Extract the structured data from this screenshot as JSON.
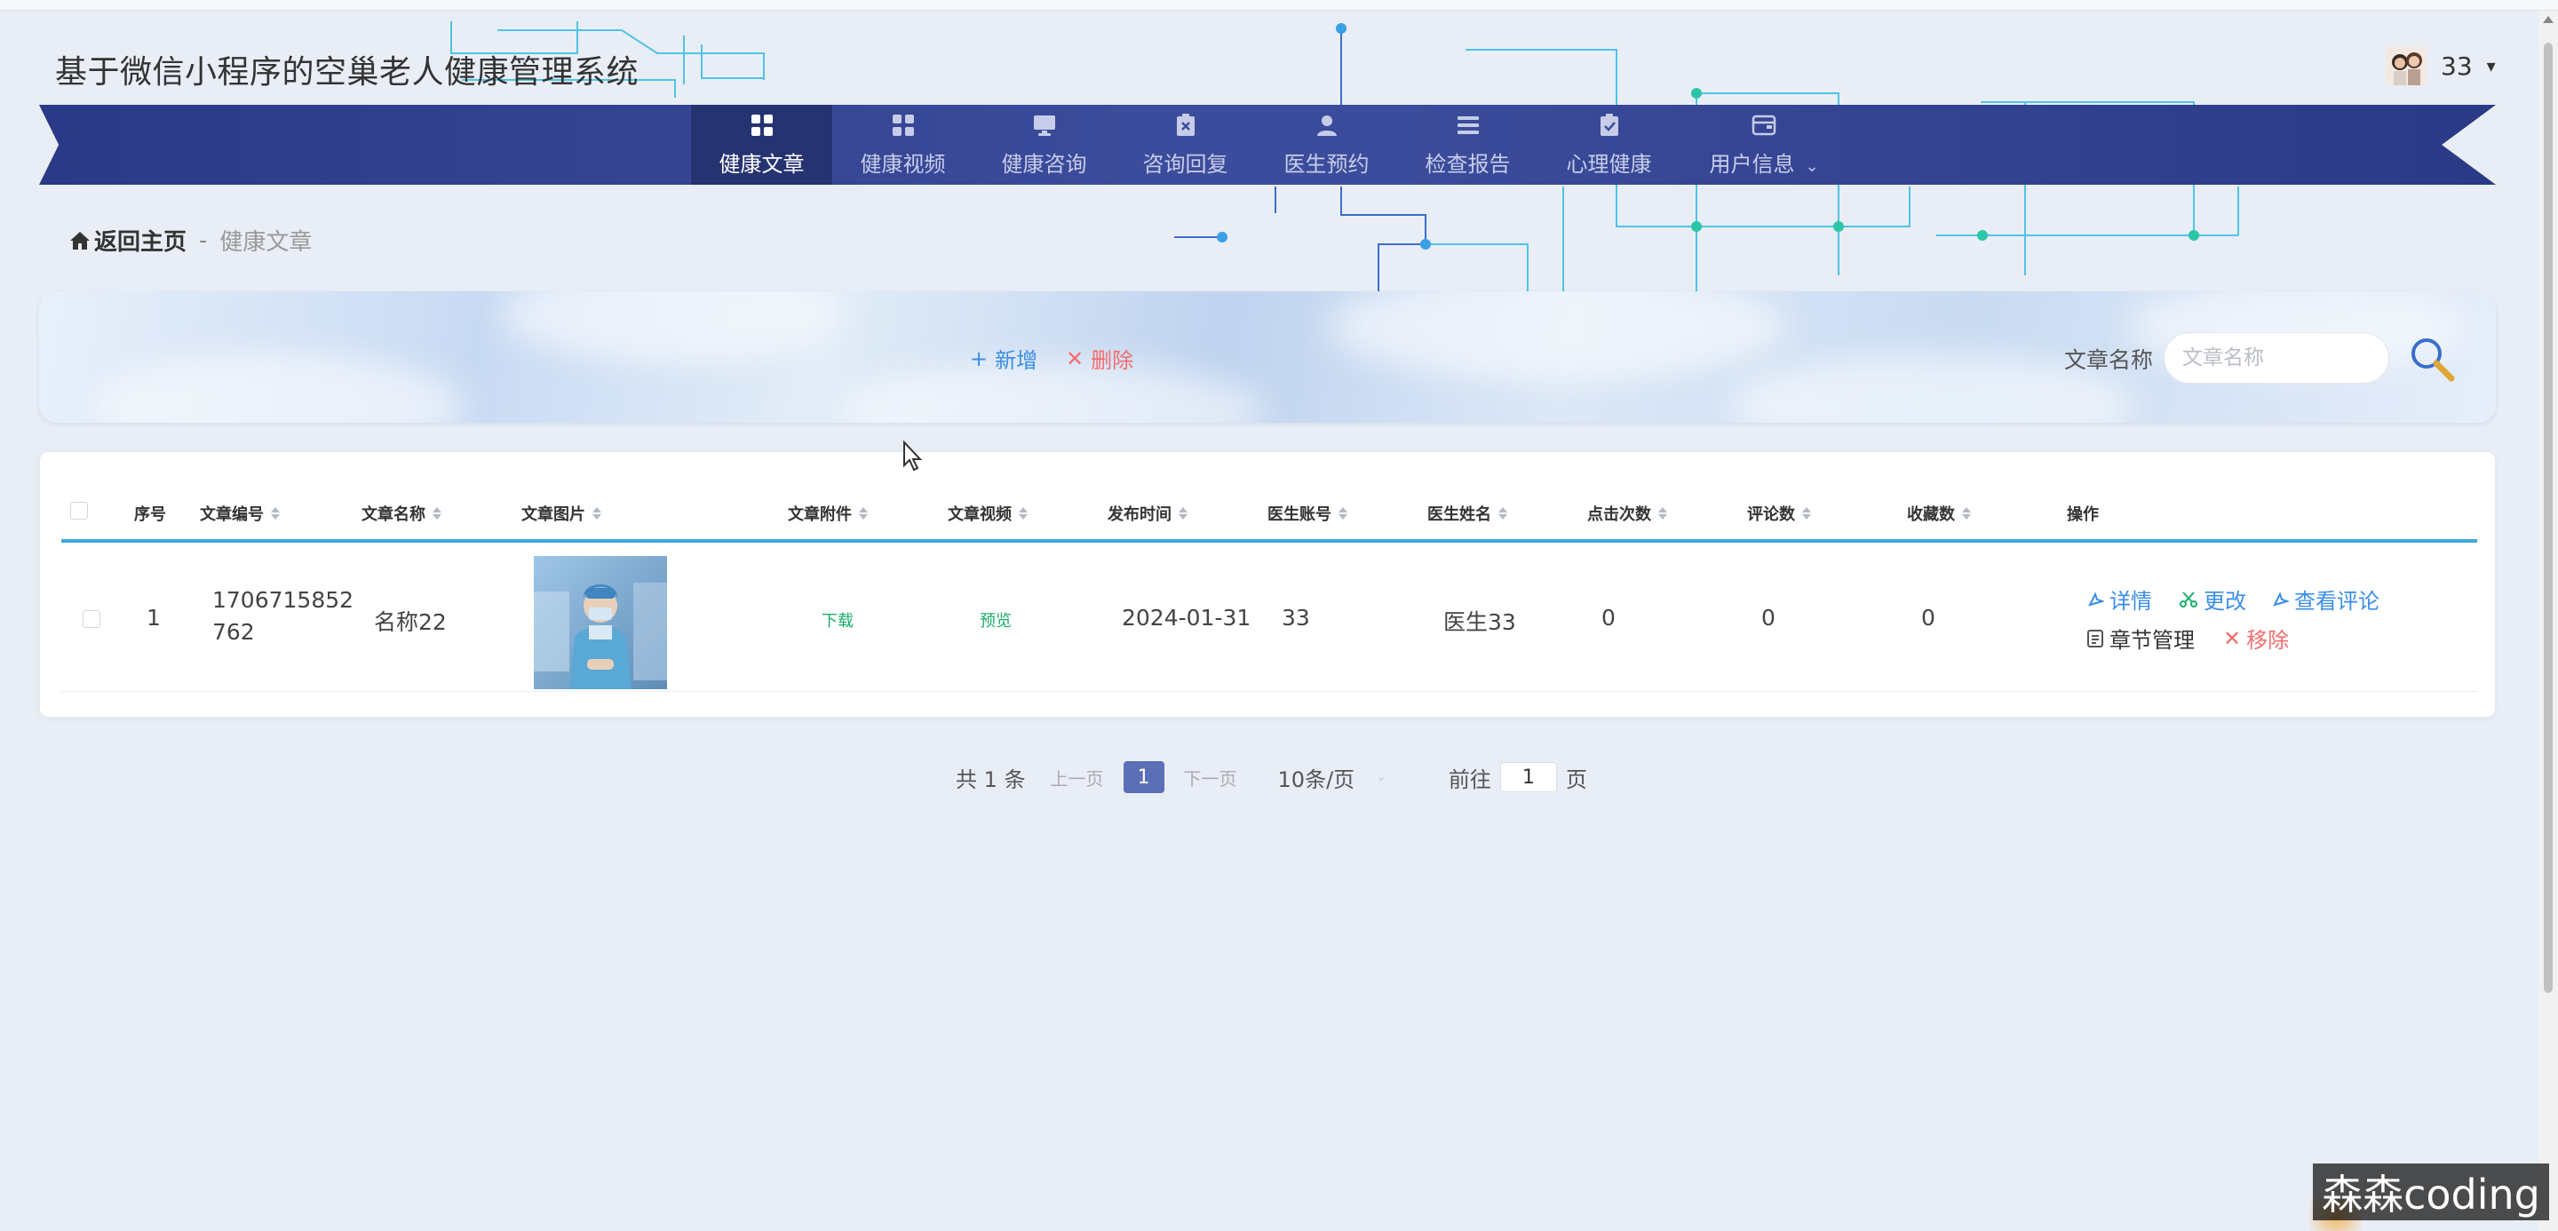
{
  "header": {
    "site_title": "基于微信小程序的空巢老人健康管理系统",
    "user_name": "33",
    "caret": "▾"
  },
  "nav": {
    "items": [
      {
        "label": "健康文章",
        "icon": "grid-icon",
        "active": true
      },
      {
        "label": "健康视频",
        "icon": "grid-icon",
        "active": false
      },
      {
        "label": "健康咨询",
        "icon": "monitor-icon",
        "active": false
      },
      {
        "label": "咨询回复",
        "icon": "clipboard-x-icon",
        "active": false
      },
      {
        "label": "医生预约",
        "icon": "user-icon",
        "active": false
      },
      {
        "label": "检查报告",
        "icon": "list-icon",
        "active": false
      },
      {
        "label": "心理健康",
        "icon": "clipboard-check-icon",
        "active": false
      },
      {
        "label": "用户信息",
        "icon": "wallet-icon",
        "active": false
      }
    ],
    "more_chevron": "⌄"
  },
  "breadcrumb": {
    "home": "返回主页",
    "separator": "-",
    "current": "健康文章"
  },
  "toolbar": {
    "add_icon": "+",
    "add_label": "新增",
    "delete_icon": "✕",
    "delete_label": "删除",
    "search_label": "文章名称",
    "search_placeholder": "文章名称",
    "search_value": ""
  },
  "table": {
    "columns": [
      "序号",
      "文章编号",
      "文章名称",
      "文章图片",
      "文章附件",
      "文章视频",
      "发布时间",
      "医生账号",
      "医生姓名",
      "点击次数",
      "评论数",
      "收藏数",
      "操作"
    ],
    "rows": [
      {
        "index": "1",
        "article_no_line1": "1706715852",
        "article_no_line2": "762",
        "name": "名称22",
        "attachment": "下载",
        "video": "预览",
        "publish_time": "2024-01-31",
        "doctor_account": "33",
        "doctor_name": "医生33",
        "clicks": "0",
        "comments": "0",
        "favorites": "0",
        "actions": {
          "detail": "详情",
          "edit": "更改",
          "view_comments": "查看评论",
          "chapter": "章节管理",
          "remove": "移除"
        }
      }
    ]
  },
  "pagination": {
    "total": "共 1 条",
    "prev": "上一页",
    "page": "1",
    "next": "下一页",
    "page_size": "10条/页",
    "goto_prefix": "前往",
    "goto_value": "1",
    "goto_suffix": "页"
  },
  "watermark": "森森coding",
  "colors": {
    "nav_bg": "#3c4c9c",
    "nav_active": "#263371",
    "accent_blue": "#3a8ee6",
    "danger": "#f56c6c",
    "success": "#1aad6a",
    "table_line": "#3ea8d8",
    "page_active": "#5a6fb8"
  }
}
